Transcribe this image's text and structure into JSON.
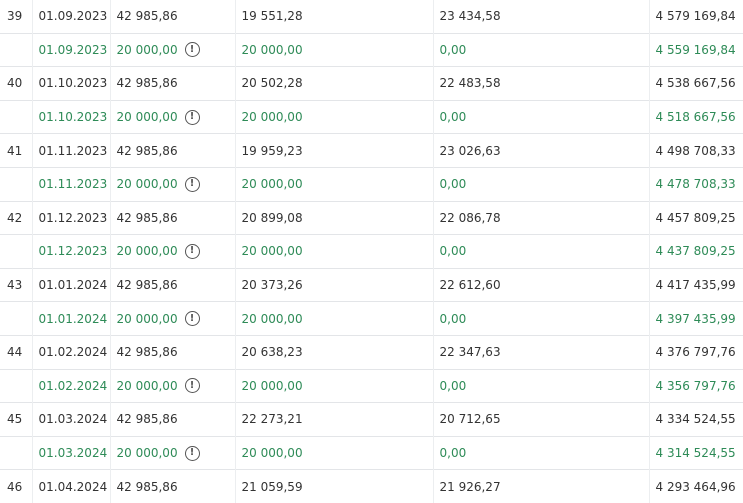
{
  "table": {
    "rows": [
      {
        "num": "39",
        "date": "01.09.2023",
        "payment": "42 985,86",
        "interest": "19 551,28",
        "principal": "23 434,58",
        "balance": "4 579 169,84",
        "prepayment": {
          "date": "01.09.2023",
          "payment": "20 000,00",
          "interest": "20 000,00",
          "principal": "0,00",
          "balance": "4 559 169,84"
        }
      },
      {
        "num": "40",
        "date": "01.10.2023",
        "payment": "42 985,86",
        "interest": "20 502,28",
        "principal": "22 483,58",
        "balance": "4 538 667,56",
        "prepayment": {
          "date": "01.10.2023",
          "payment": "20 000,00",
          "interest": "20 000,00",
          "principal": "0,00",
          "balance": "4 518 667,56"
        }
      },
      {
        "num": "41",
        "date": "01.11.2023",
        "payment": "42 985,86",
        "interest": "19 959,23",
        "principal": "23 026,63",
        "balance": "4 498 708,33",
        "prepayment": {
          "date": "01.11.2023",
          "payment": "20 000,00",
          "interest": "20 000,00",
          "principal": "0,00",
          "balance": "4 478 708,33"
        }
      },
      {
        "num": "42",
        "date": "01.12.2023",
        "payment": "42 985,86",
        "interest": "20 899,08",
        "principal": "22 086,78",
        "balance": "4 457 809,25",
        "prepayment": {
          "date": "01.12.2023",
          "payment": "20 000,00",
          "interest": "20 000,00",
          "principal": "0,00",
          "balance": "4 437 809,25"
        }
      },
      {
        "num": "43",
        "date": "01.01.2024",
        "payment": "42 985,86",
        "interest": "20 373,26",
        "principal": "22 612,60",
        "balance": "4 417 435,99",
        "prepayment": {
          "date": "01.01.2024",
          "payment": "20 000,00",
          "interest": "20 000,00",
          "principal": "0,00",
          "balance": "4 397 435,99"
        }
      },
      {
        "num": "44",
        "date": "01.02.2024",
        "payment": "42 985,86",
        "interest": "20 638,23",
        "principal": "22 347,63",
        "balance": "4 376 797,76",
        "prepayment": {
          "date": "01.02.2024",
          "payment": "20 000,00",
          "interest": "20 000,00",
          "principal": "0,00",
          "balance": "4 356 797,76"
        }
      },
      {
        "num": "45",
        "date": "01.03.2024",
        "payment": "42 985,86",
        "interest": "22 273,21",
        "principal": "20 712,65",
        "balance": "4 334 524,55",
        "prepayment": {
          "date": "01.03.2024",
          "payment": "20 000,00",
          "interest": "20 000,00",
          "principal": "0,00",
          "balance": "4 314 524,55"
        }
      },
      {
        "num": "46",
        "date": "01.04.2024",
        "payment": "42 985,86",
        "interest": "21 059,59",
        "principal": "21 926,27",
        "balance": "4 293 464,96"
      }
    ]
  },
  "icons": {
    "info": "info-circle-icon",
    "info_glyph": "!"
  },
  "colors": {
    "text": "#333333",
    "prepayment_text": "#2e8b57",
    "grid": "#e3e5e8",
    "icon": "#555555"
  }
}
